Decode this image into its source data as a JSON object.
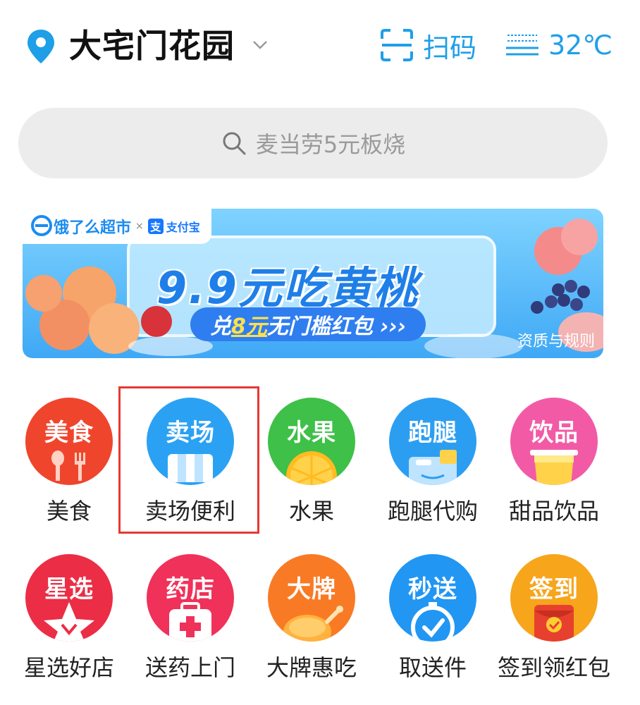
{
  "header": {
    "location": "大宅门花园",
    "scan_label": "扫码",
    "weather_temp": "32℃"
  },
  "search": {
    "placeholder": "麦当劳5元板烧"
  },
  "banner": {
    "brand1": "饿了么超市",
    "x": "×",
    "brand2": "支付宝",
    "brand2_icon": "支",
    "title": "9.9元吃黄桃",
    "sub_pre": "兑",
    "sub_hl": "8元",
    "sub_post": "无门槛红包 ›››",
    "rule": "资质与规则"
  },
  "categories": [
    {
      "icon_text": "美食",
      "label": "美食",
      "color": "#f0452d"
    },
    {
      "icon_text": "卖场",
      "label": "卖场便利",
      "color": "#2ba1f3"
    },
    {
      "icon_text": "水果",
      "label": "水果",
      "color": "#3fc048"
    },
    {
      "icon_text": "跑腿",
      "label": "跑腿代购",
      "color": "#2c9ef2"
    },
    {
      "icon_text": "饮品",
      "label": "甜品饮品",
      "color": "#f25aa6"
    },
    {
      "icon_text": "星选",
      "label": "星选好店",
      "color": "#ec2d46"
    },
    {
      "icon_text": "药店",
      "label": "送药上门",
      "color": "#f0315a"
    },
    {
      "icon_text": "大牌",
      "label": "大牌惠吃",
      "color": "#f97a25"
    },
    {
      "icon_text": "秒送",
      "label": "取送件",
      "color": "#2196f3"
    },
    {
      "icon_text": "签到",
      "label": "签到领红包",
      "color": "#f7a51b"
    }
  ]
}
